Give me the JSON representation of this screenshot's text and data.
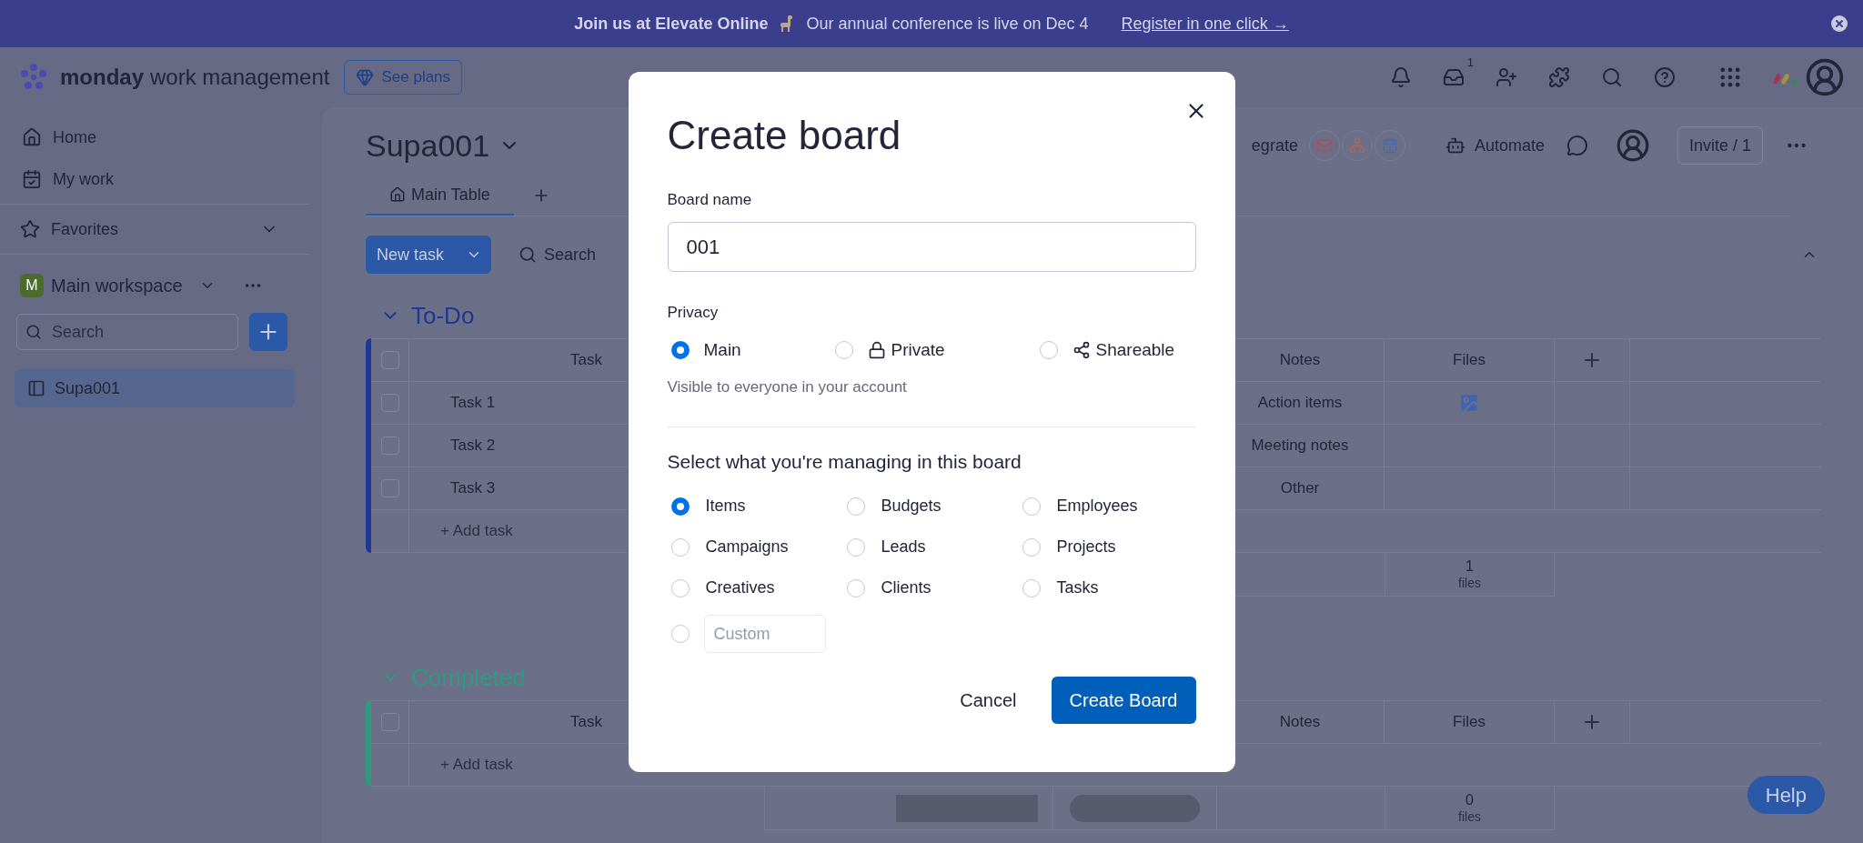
{
  "banner": {
    "lead": "Join us at Elevate Online",
    "message": "Our annual conference is live on Dec 4",
    "link": "Register in one click →"
  },
  "topnav": {
    "brand": "monday",
    "product": "work management",
    "plans_button": "See plans",
    "inbox_badge": "1"
  },
  "sidebar": {
    "nav": [
      {
        "kind": "home",
        "label": "Home"
      },
      {
        "kind": "calendar",
        "label": "My work"
      }
    ],
    "favorites": "Favorites",
    "workspace": {
      "initial": "M",
      "name": "Main workspace"
    },
    "search_placeholder": "Search",
    "boards": [
      {
        "label": "Supa001",
        "selected": true
      }
    ]
  },
  "board": {
    "title": "Supa001",
    "views": [
      {
        "label": "Main Table",
        "selected": true
      }
    ],
    "new_task": "New task",
    "search": "Search",
    "integrate": "egrate",
    "automate": "Automate",
    "invite": "Invite / 1",
    "groups": [
      {
        "title": "To-Do",
        "color": "#1d3894",
        "all_checked": false,
        "columns": [
          "Task",
          "Notes",
          "Files"
        ],
        "rows": [
          {
            "task": "Task 1",
            "notes": "Action items",
            "has_file": true,
            "checked": false
          },
          {
            "task": "Task 2",
            "notes": "Meeting notes",
            "has_file": false,
            "checked": false
          },
          {
            "task": "Task 3",
            "notes": "Other",
            "has_file": false,
            "checked": false
          }
        ],
        "add_label": "+ Add task",
        "summary_bars": false,
        "files_count": "1",
        "files_unit": "files"
      },
      {
        "title": "Completed",
        "color": "#2d9b80",
        "all_checked": false,
        "columns": [
          "Task",
          "Notes",
          "Files"
        ],
        "add_label": "+ Add task",
        "summary_bars": true,
        "files_count": "0",
        "files_unit": "files"
      }
    ]
  },
  "modal": {
    "title": "Create board",
    "board_name_label": "Board name",
    "board_name_value": "001",
    "privacy_label": "Privacy",
    "privacy_options": [
      {
        "kind": "plain",
        "label": "Main",
        "selected": true
      },
      {
        "kind": "lock",
        "label": "Private",
        "selected": false
      },
      {
        "kind": "share",
        "label": "Shareable",
        "selected": false
      }
    ],
    "privacy_hint": "Visible to everyone in your account",
    "managing_title": "Select what you're managing in this board",
    "managing_options": [
      {
        "label": "Items",
        "selected": true
      },
      {
        "label": "Budgets",
        "selected": false
      },
      {
        "label": "Employees",
        "selected": false
      },
      {
        "label": "Campaigns",
        "selected": false
      },
      {
        "label": "Leads",
        "selected": false
      },
      {
        "label": "Projects",
        "selected": false
      },
      {
        "label": "Creatives",
        "selected": false
      },
      {
        "label": "Clients",
        "selected": false
      },
      {
        "label": "Tasks",
        "selected": false
      }
    ],
    "custom": {
      "placeholder": "Custom",
      "selected": false
    },
    "cancel": "Cancel",
    "create": "Create Board"
  },
  "help": "Help"
}
